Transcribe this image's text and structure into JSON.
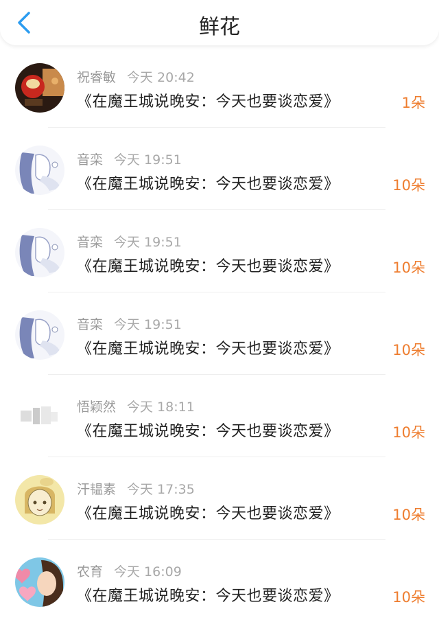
{
  "header": {
    "title": "鲜花",
    "back_icon": "chevron-left-icon",
    "accent_color": "#2b9cf0"
  },
  "items": [
    {
      "name": "祝睿敏",
      "time": "今天 20:42",
      "book": "《在魔王城说晚安：今天也要谈恋爱》",
      "count": "1朵",
      "avatar": "lantern-photo"
    },
    {
      "name": "音栾",
      "time": "今天 19:51",
      "book": "《在魔王城说晚安：今天也要谈恋爱》",
      "count": "10朵",
      "avatar": "anime-girl-sketch"
    },
    {
      "name": "音栾",
      "time": "今天 19:51",
      "book": "《在魔王城说晚安：今天也要谈恋爱》",
      "count": "10朵",
      "avatar": "anime-girl-sketch"
    },
    {
      "name": "音栾",
      "time": "今天 19:51",
      "book": "《在魔王城说晚安：今天也要谈恋爱》",
      "count": "10朵",
      "avatar": "anime-girl-sketch"
    },
    {
      "name": "悟颖然",
      "time": "今天 18:11",
      "book": "《在魔王城说晚安：今天也要谈恋爱》",
      "count": "10朵",
      "avatar": "blurred-photo"
    },
    {
      "name": "汗韫素",
      "time": "今天 17:35",
      "book": "《在魔王城说晚安：今天也要谈恋爱》",
      "count": "10朵",
      "avatar": "yellow-sketch-girl"
    },
    {
      "name": "农育",
      "time": "今天 16:09",
      "book": "《在魔王城说晚安：今天也要谈恋爱》",
      "count": "10朵",
      "avatar": "kissing-cartoon"
    }
  ]
}
